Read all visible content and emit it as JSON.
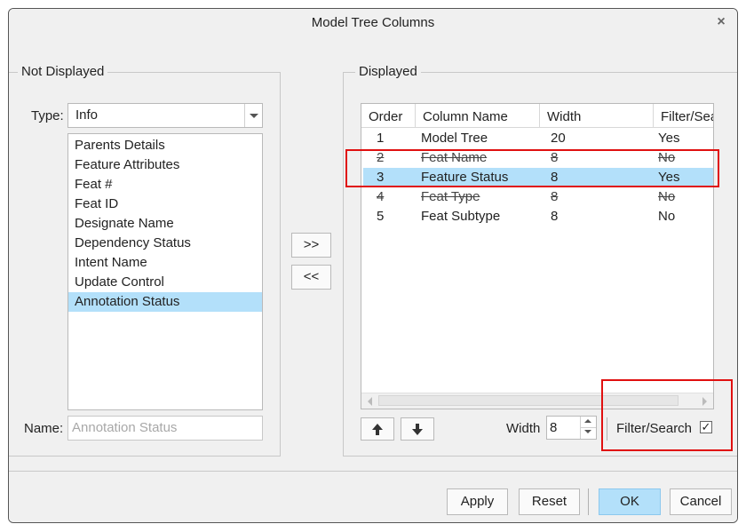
{
  "window": {
    "title": "Model Tree Columns",
    "close_icon": "×"
  },
  "not_displayed": {
    "legend": "Not Displayed",
    "type_label": "Type:",
    "type_value": "Info",
    "items": [
      "Parents Details",
      "Feature Attributes",
      "Feat #",
      "Feat ID",
      "Designate Name",
      "Dependency Status",
      "Intent Name",
      "Update Control",
      "Annotation Status"
    ],
    "selected_index": 8,
    "name_label": "Name:",
    "name_value": "Annotation Status"
  },
  "transfer": {
    "add_label": ">>",
    "remove_label": "<<"
  },
  "displayed": {
    "legend": "Displayed",
    "columns": [
      "Order",
      "Column Name",
      "Width",
      "Filter/Search"
    ],
    "rows": [
      {
        "order": "1",
        "name": "Model Tree",
        "width": "20",
        "filter": "Yes"
      },
      {
        "order": "2",
        "name": "Feat Name",
        "width": "8",
        "filter": "No"
      },
      {
        "order": "3",
        "name": "Feature Status",
        "width": "8",
        "filter": "Yes"
      },
      {
        "order": "4",
        "name": "Feat Type",
        "width": "8",
        "filter": "No"
      },
      {
        "order": "5",
        "name": "Feat Subtype",
        "width": "8",
        "filter": "No"
      }
    ],
    "selected_row": 2,
    "width_label": "Width",
    "width_value": "8",
    "filter_label": "Filter/Search",
    "filter_checked": true
  },
  "footer": {
    "apply": "Apply",
    "reset": "Reset",
    "ok": "OK",
    "cancel": "Cancel"
  },
  "colors": {
    "selection": "#b3e0fa",
    "highlight_box": "#e01010",
    "background": "#f0f0f0"
  }
}
